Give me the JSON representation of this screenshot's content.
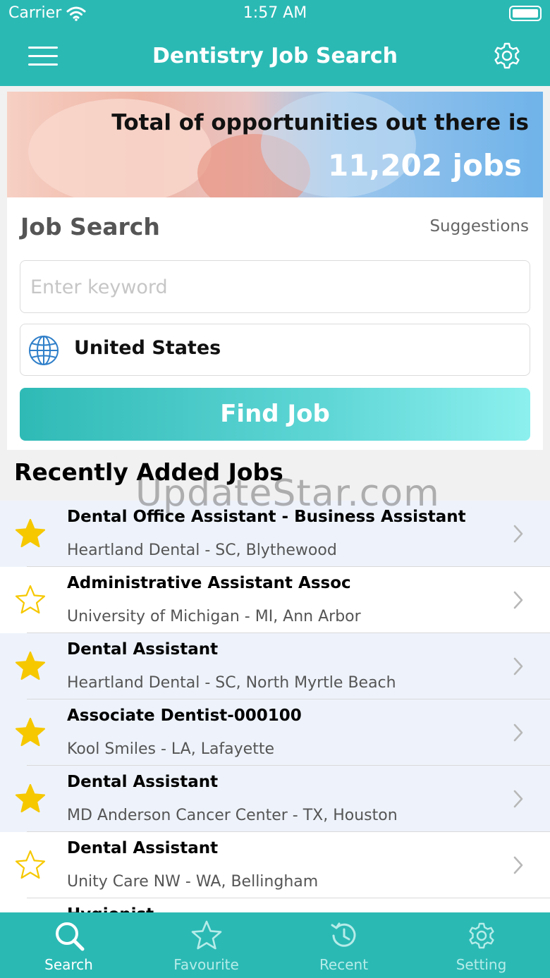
{
  "status_bar": {
    "carrier": "Carrier",
    "time": "1:57 AM"
  },
  "nav": {
    "title": "Dentistry Job Search"
  },
  "banner": {
    "headline": "Total of opportunities out there is",
    "count": "11,202 jobs"
  },
  "search": {
    "heading": "Job Search",
    "suggestions_label": "Suggestions",
    "keyword_placeholder": "Enter keyword",
    "keyword_value": "",
    "country": "United States",
    "find_label": "Find Job"
  },
  "recent": {
    "heading": "Recently Added Jobs",
    "jobs": [
      {
        "title": "Dental Office Assistant - Business Assistant",
        "subtitle": "Heartland Dental - SC, Blythewood",
        "favourite": true
      },
      {
        "title": "Administrative Assistant Assoc",
        "subtitle": "University of Michigan - MI, Ann Arbor",
        "favourite": false
      },
      {
        "title": "Dental Assistant",
        "subtitle": "Heartland Dental - SC, North Myrtle Beach",
        "favourite": true
      },
      {
        "title": "Associate Dentist-000100",
        "subtitle": "Kool Smiles - LA, Lafayette",
        "favourite": true
      },
      {
        "title": "Dental Assistant",
        "subtitle": "MD Anderson Cancer Center - TX, Houston",
        "favourite": true
      },
      {
        "title": "Dental Assistant",
        "subtitle": "Unity Care NW - WA, Bellingham",
        "favourite": false
      },
      {
        "title": "Hygienist",
        "subtitle": "",
        "favourite": false
      }
    ]
  },
  "watermark": "UpdateStar.com",
  "tabs": [
    {
      "label": "Search",
      "icon": "search-icon",
      "active": true
    },
    {
      "label": "Favourite",
      "icon": "star-icon",
      "active": false
    },
    {
      "label": "Recent",
      "icon": "history-icon",
      "active": false
    },
    {
      "label": "Setting",
      "icon": "gear-icon",
      "active": false
    }
  ],
  "colors": {
    "primary": "#2bb9b4",
    "star_gold": "#f6c800",
    "row_shade": "#eef3fb"
  }
}
